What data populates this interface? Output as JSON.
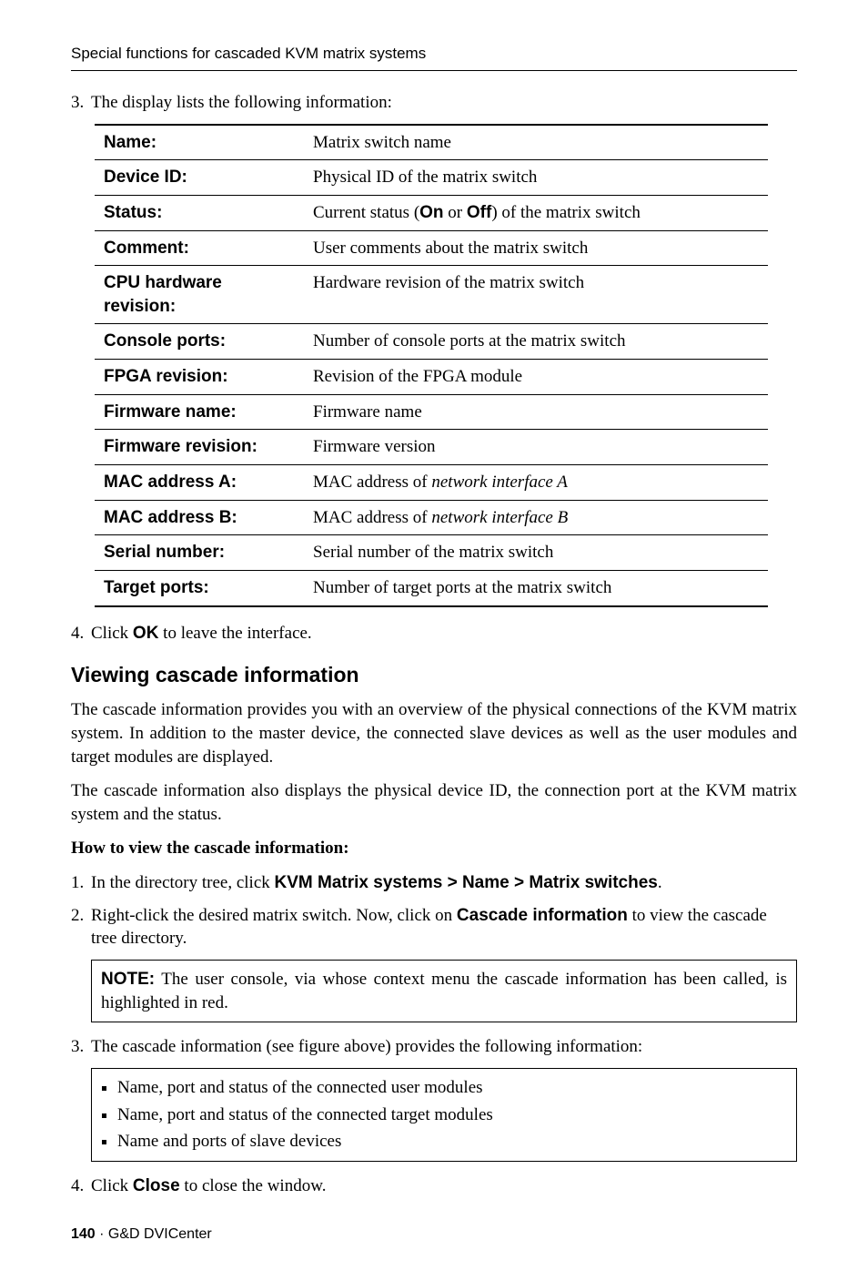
{
  "header": "Special functions for cascaded KVM matrix systems",
  "step3": {
    "num": "3.",
    "text": "The display lists the following information:"
  },
  "table": [
    {
      "label": "Name:",
      "value": "Matrix switch name"
    },
    {
      "label": "Device ID:",
      "value": "Physical ID of the matrix switch"
    },
    {
      "label": "Status:",
      "value_before": "Current status (",
      "bold1": "On",
      "mid": " or ",
      "bold2": "Off",
      "value_after": ") of the matrix switch"
    },
    {
      "label": "Comment:",
      "value": "User comments about the matrix switch"
    },
    {
      "label": "CPU hardware revision:",
      "value": "Hardware revision of the matrix switch"
    },
    {
      "label": "Console ports:",
      "value": "Number of console ports at the matrix switch"
    },
    {
      "label": "FPGA revision:",
      "value": "Revision of the FPGA module"
    },
    {
      "label": "Firmware name:",
      "value": "Firmware name"
    },
    {
      "label": "Firmware revision:",
      "value": "Firmware version"
    },
    {
      "label": "MAC address A:",
      "value_pre": "MAC address of ",
      "italic": "network interface A"
    },
    {
      "label": "MAC address B:",
      "value_pre": "MAC address of ",
      "italic": "network interface B"
    },
    {
      "label": "Serial number:",
      "value": "Serial number of the matrix switch"
    },
    {
      "label": "Target ports:",
      "value": "Number of target ports at the matrix switch"
    }
  ],
  "step4": {
    "num": "4.",
    "pre": "Click ",
    "bold": "OK",
    "post": " to leave the interface."
  },
  "section_title": "Viewing cascade information",
  "para1": "The cascade information provides you with an overview of the physical connections of the KVM matrix system. In addition to the master device, the connected slave devices as well as the user modules and target modules are displayed.",
  "para2": "The cascade information also displays the physical device ID, the connection port at the KVM matrix system and the status.",
  "howto": "How to view the cascade information:",
  "list1": {
    "num": "1.",
    "pre": "In the directory tree, click ",
    "bold": "KVM Matrix systems > Name > Matrix switches",
    "post": "."
  },
  "list2": {
    "num": "2.",
    "pre": "Right-click the desired matrix switch. Now, click on ",
    "bold": "Cascade information",
    "post": " to view the cascade tree directory."
  },
  "note": {
    "lead": "NOTE:",
    "text": " The user console, via whose context menu the cascade information has been called, is highlighted in red."
  },
  "list3": {
    "num": "3.",
    "text": "The cascade information (see figure above) provides the following information:"
  },
  "bullets": [
    "Name, port and status of the connected user modules",
    "Name, port and status of the connected target modules",
    "Name and ports of slave devices"
  ],
  "list4": {
    "num": "4.",
    "pre": "Click ",
    "bold": "Close",
    "post": " to close the window."
  },
  "footer": {
    "page": "140",
    "sep": " · ",
    "title": "G&D DVICenter"
  }
}
